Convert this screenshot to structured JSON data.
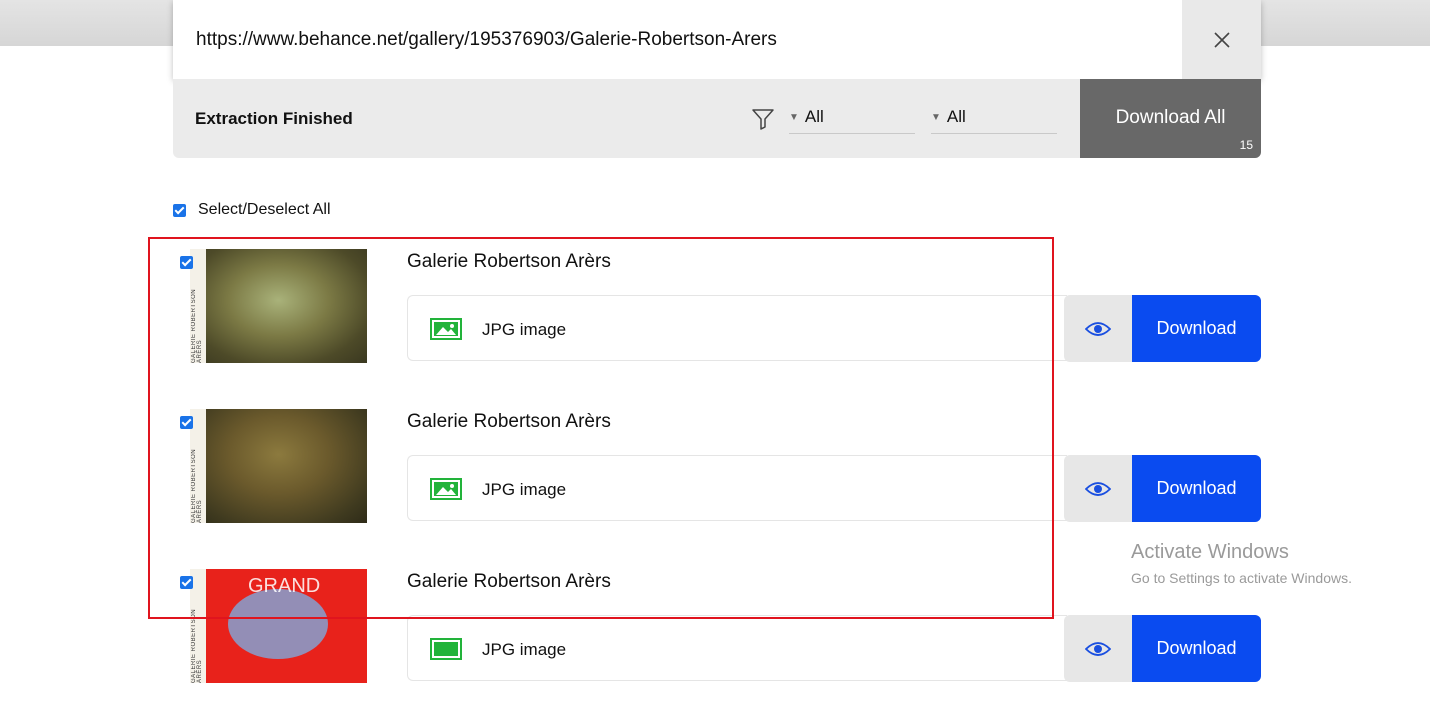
{
  "url_bar": {
    "url": "https://www.behance.net/gallery/195376903/Galerie-Robertson-Arers",
    "close_icon": "close-icon"
  },
  "status_bar": {
    "status_text": "Extraction Finished",
    "filter_icon": "filter-icon",
    "filter1_value": "All",
    "filter2_value": "All",
    "download_all_label": "Download All",
    "download_all_count": "15"
  },
  "select_all": {
    "label": "Select/Deselect All",
    "checked": true
  },
  "items": [
    {
      "title": "Galerie Robertson Arèrs",
      "file_type": "JPG image",
      "thumb_text": "GALERIE ROBERTSON ARÈRS",
      "checked": true,
      "preview_icon": "eye-icon",
      "download_label": "Download"
    },
    {
      "title": "Galerie Robertson Arèrs",
      "file_type": "JPG image",
      "thumb_text": "GALERIE ROBERTSON ARÈRS",
      "checked": true,
      "preview_icon": "eye-icon",
      "download_label": "Download"
    },
    {
      "title": "Galerie Robertson Arèrs",
      "file_type": "JPG image",
      "thumb_text": "GALERIE ROBERTSON ARÈRS",
      "thumb_overlay_text": "GRAND",
      "checked": true,
      "preview_icon": "eye-icon",
      "download_label": "Download"
    }
  ],
  "watermark": {
    "line1": "Activate Windows",
    "line2": "Go to Settings to activate Windows."
  },
  "colors": {
    "download_button": "#0a4bf0",
    "download_all_button": "#686868",
    "image_icon": "#22b33a",
    "eye_icon": "#1a4fe0",
    "highlight_border": "#e0141e"
  }
}
